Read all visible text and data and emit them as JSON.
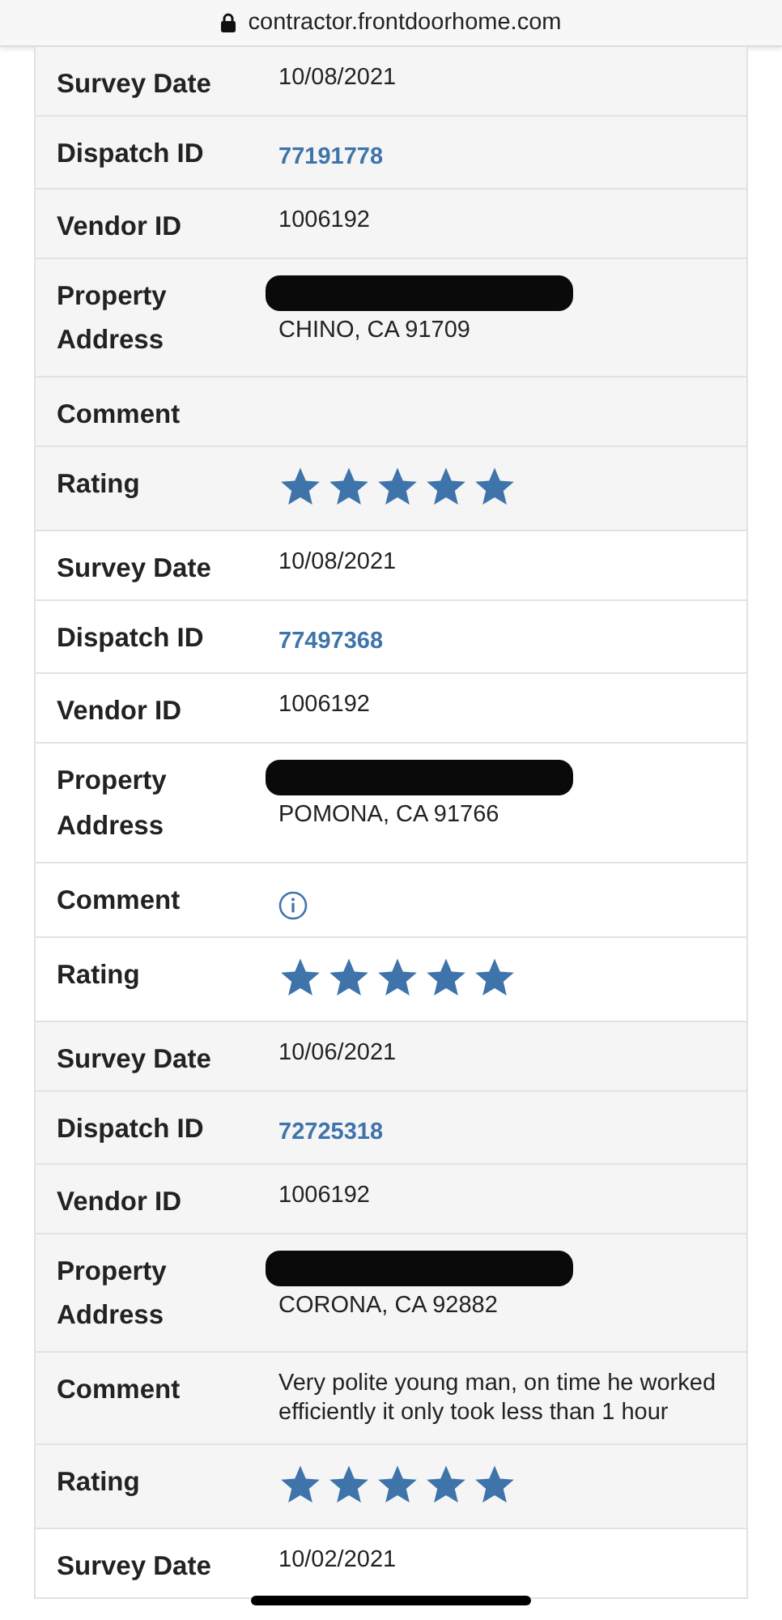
{
  "address_bar": {
    "url": "contractor.frontdoorhome.com",
    "secure": true
  },
  "records": [
    {
      "rows": [
        {
          "label": "Survey Date",
          "kind": "text",
          "value": "10/08/2021"
        },
        {
          "label": "Dispatch ID",
          "kind": "link",
          "value": "77191778"
        },
        {
          "label": "Vendor ID",
          "kind": "text",
          "value": "1006192"
        },
        {
          "label": "Property Address",
          "kind": "address",
          "redacted": true,
          "value": "CHINO, CA 91709"
        },
        {
          "label": "Comment",
          "kind": "empty"
        },
        {
          "label": "Rating",
          "kind": "stars",
          "stars": 5
        }
      ]
    },
    {
      "rows": [
        {
          "label": "Survey Date",
          "kind": "text",
          "value": "10/08/2021"
        },
        {
          "label": "Dispatch ID",
          "kind": "link",
          "value": "77497368"
        },
        {
          "label": "Vendor ID",
          "kind": "text",
          "value": "1006192"
        },
        {
          "label": "Property Address",
          "kind": "address",
          "redacted": true,
          "value": "POMONA, CA 91766"
        },
        {
          "label": "Comment",
          "kind": "info"
        },
        {
          "label": "Rating",
          "kind": "stars",
          "stars": 5
        }
      ]
    },
    {
      "rows": [
        {
          "label": "Survey Date",
          "kind": "text",
          "value": "10/06/2021"
        },
        {
          "label": "Dispatch ID",
          "kind": "link",
          "value": "72725318"
        },
        {
          "label": "Vendor ID",
          "kind": "text",
          "value": "1006192"
        },
        {
          "label": "Property Address",
          "kind": "address",
          "redacted": true,
          "value": "CORONA, CA 92882"
        },
        {
          "label": "Comment",
          "kind": "text",
          "value": "Very polite young man, on time he worked efficiently it only took less than 1 hour"
        },
        {
          "label": "Rating",
          "kind": "stars",
          "stars": 5
        }
      ]
    },
    {
      "rows": [
        {
          "label": "Survey Date",
          "kind": "text",
          "value": "10/02/2021"
        }
      ]
    }
  ]
}
